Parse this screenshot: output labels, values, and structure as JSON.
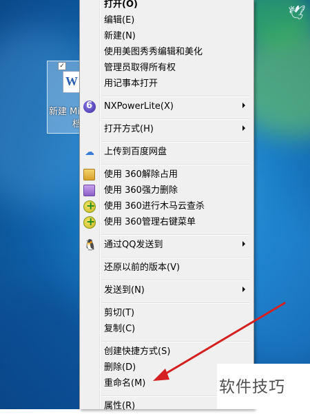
{
  "desktop_file": {
    "label": "新建 Mi",
    "label_line2": "档"
  },
  "context_menu": {
    "groups": [
      {
        "items": [
          {
            "label": "打开(O)",
            "bold": true
          },
          {
            "label": "编辑(E)"
          },
          {
            "label": "新建(N)"
          },
          {
            "label": "使用美图秀秀编辑和美化"
          },
          {
            "label": "管理员取得所有权"
          },
          {
            "label": "用记事本打开"
          }
        ]
      },
      {
        "items": [
          {
            "label": "NXPowerLite(X)",
            "icon": "nxpowerlite-icon",
            "submenu": true
          }
        ]
      },
      {
        "items": [
          {
            "label": "打开方式(H)",
            "submenu": true
          }
        ]
      },
      {
        "items": [
          {
            "label": "上传到百度网盘",
            "icon": "baidu-netdisk-icon"
          }
        ]
      },
      {
        "items": [
          {
            "label": "使用 360解除占用",
            "icon": "360-unlock-icon"
          },
          {
            "label": "使用 360强力删除",
            "icon": "360-force-delete-icon"
          },
          {
            "label": "使用 360进行木马云查杀",
            "icon": "360-trojan-scan-icon"
          },
          {
            "label": "使用 360管理右键菜单",
            "icon": "360-menu-manager-icon"
          }
        ]
      },
      {
        "items": [
          {
            "label": "通过QQ发送到",
            "icon": "qq-penguin-icon",
            "submenu": true
          }
        ]
      },
      {
        "items": [
          {
            "label": "还原以前的版本(V)"
          }
        ]
      },
      {
        "items": [
          {
            "label": "发送到(N)",
            "submenu": true
          }
        ]
      },
      {
        "items": [
          {
            "label": "剪切(T)"
          },
          {
            "label": "复制(C)"
          }
        ]
      },
      {
        "items": [
          {
            "label": "创建快捷方式(S)"
          },
          {
            "label": "删除(D)"
          },
          {
            "label": "重命名(M)"
          }
        ]
      },
      {
        "items": [
          {
            "label": "属性(R)"
          }
        ]
      }
    ]
  },
  "watermark": "软件技巧",
  "colors": {
    "menu_bg": "#f0f0f0",
    "annotation_arrow": "#d42020",
    "desktop_blue": "#1b7fc7"
  }
}
